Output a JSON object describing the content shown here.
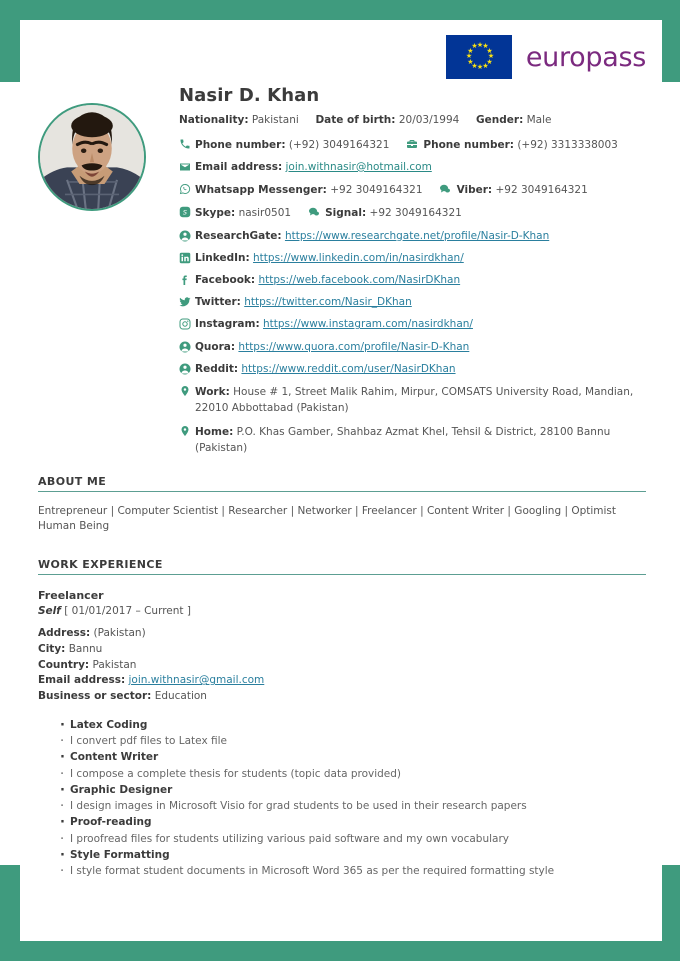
{
  "logo": {
    "text": "europass",
    "flag_alt": "eu-flag"
  },
  "person": {
    "name": "Nasir D. Khan",
    "nationality_label": "Nationality:",
    "nationality": "Pakistani",
    "dob_label": "Date of birth:",
    "dob": "20/03/1994",
    "gender_label": "Gender:",
    "gender": "Male"
  },
  "contacts": [
    {
      "icon": "phone-icon",
      "label": "Phone number:",
      "value": "(+92) 3049164321",
      "label2": "Phone number:",
      "value2": "(+92) 3313338003",
      "icon2": "briefcase-icon"
    },
    {
      "icon": "email-icon",
      "label": "Email address:",
      "link": "join.withnasir@hotmail.com"
    },
    {
      "icon": "whatsapp-icon",
      "label": "Whatsapp Messenger:",
      "value": "+92 3049164321",
      "icon2": "viber-icon",
      "label2": "Viber:",
      "value2": "+92 3049164321"
    },
    {
      "icon": "skype-icon",
      "label": "Skype:",
      "value": "nasir0501",
      "icon2": "signal-icon",
      "label2": "Signal:",
      "value2": "+92 3049164321"
    },
    {
      "icon": "researchgate-icon",
      "label": "ResearchGate:",
      "link": "https://www.researchgate.net/profile/Nasir-D-Khan"
    },
    {
      "icon": "linkedin-icon",
      "label": "LinkedIn:",
      "link": "https://www.linkedin.com/in/nasirdkhan/"
    },
    {
      "icon": "facebook-icon",
      "label": "Facebook:",
      "link": "https://web.facebook.com/NasirDKhan"
    },
    {
      "icon": "twitter-icon",
      "label": "Twitter:",
      "link": "https://twitter.com/Nasir_DKhan"
    },
    {
      "icon": "instagram-icon",
      "label": "Instagram:",
      "link": "https://www.instagram.com/nasirdkhan/"
    },
    {
      "icon": "quora-icon",
      "label": "Quora:",
      "link": "https://www.quora.com/profile/Nasir-D-Khan"
    },
    {
      "icon": "reddit-icon",
      "label": "Reddit:",
      "link": "https://www.reddit.com/user/NasirDKhan"
    }
  ],
  "addresses": [
    {
      "icon": "map-pin-icon",
      "label": "Work:",
      "value": "House # 1, Street Malik Rahim, Mirpur, COMSATS University Road, Mandian, 22010 Abbottabad (Pakistan)"
    },
    {
      "icon": "map-pin-icon",
      "label": "Home:",
      "value": "P.O. Khas Gamber, Shahbaz Azmat Khel, Tehsil & District, 28100 Bannu (Pakistan)"
    }
  ],
  "about": {
    "title": "ABOUT ME",
    "text": "Entrepreneur | Computer Scientist | Researcher | Networker | Freelancer | Content Writer | Googling | Optimist Human Being"
  },
  "work": {
    "title": "WORK EXPERIENCE",
    "job_title": "Freelancer",
    "employer": "Self",
    "period": "[ 01/01/2017 – Current ]",
    "details": [
      {
        "label": "Address:",
        "value": "(Pakistan)"
      },
      {
        "label": "City:",
        "value": "Bannu"
      },
      {
        "label": "Country:",
        "value": "Pakistan"
      },
      {
        "label": "Email address:",
        "link": "join.withnasir@gmail.com"
      },
      {
        "label": "Business or sector:",
        "value": "Education"
      }
    ],
    "bullets": [
      {
        "text": "Latex Coding",
        "strong": true
      },
      {
        "text": "I convert pdf files to Latex file",
        "strong": false
      },
      {
        "text": "Content Writer",
        "strong": true
      },
      {
        "text": "I compose a complete thesis for students (topic data provided)",
        "strong": false
      },
      {
        "text": "Graphic Designer",
        "strong": true
      },
      {
        "text": "I design images in Microsoft Visio for grad students to be used in their research papers",
        "strong": false
      },
      {
        "text": "Proof-reading",
        "strong": true
      },
      {
        "text": "I proofread files for students utilizing various paid software and my own vocabulary",
        "strong": false
      },
      {
        "text": "Style Formatting",
        "strong": true
      },
      {
        "text": "I style format student documents in Microsoft Word 365 as per the required formatting style",
        "strong": false
      }
    ]
  },
  "colors": {
    "frame_green": "#3f9b7e",
    "icon_green": "#3f9b7e",
    "link_blue": "#2a7f9e",
    "logo_purple": "#7b2a7f",
    "flag_blue": "#023596"
  }
}
